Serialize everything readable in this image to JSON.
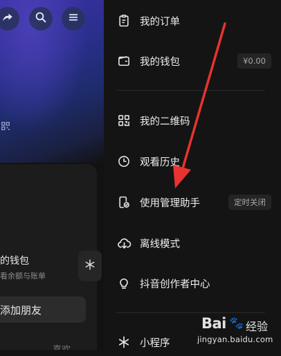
{
  "left_panel": {
    "wallet_title": "的钱包",
    "wallet_subtitle": "看余额与账单",
    "add_friend": "添加朋友",
    "bottom_peek": "喜欢"
  },
  "menu": {
    "items": [
      {
        "label": "我的订单",
        "icon": "clipboard-icon"
      },
      {
        "label": "我的钱包",
        "icon": "wallet-icon",
        "badge": "¥0.00"
      },
      {
        "label": "我的二维码",
        "icon": "qr-code-icon"
      },
      {
        "label": "观看历史",
        "icon": "clock-icon"
      },
      {
        "label": "使用管理助手",
        "icon": "phone-check-icon",
        "badge": "定时关闭"
      },
      {
        "label": "离线模式",
        "icon": "cloud-download-icon"
      },
      {
        "label": "抖音创作者中心",
        "icon": "lightbulb-icon"
      },
      {
        "label": "小程序",
        "icon": "asterisk-icon"
      }
    ]
  },
  "watermark": {
    "brand": "Bai",
    "paw": "🐾",
    "brand_cn": "经验",
    "url": "jingyan.baidu.com"
  },
  "colors": {
    "background": "#141414",
    "arrow": "#e8332f",
    "hero_gradient_top": "#3b2fa4"
  }
}
